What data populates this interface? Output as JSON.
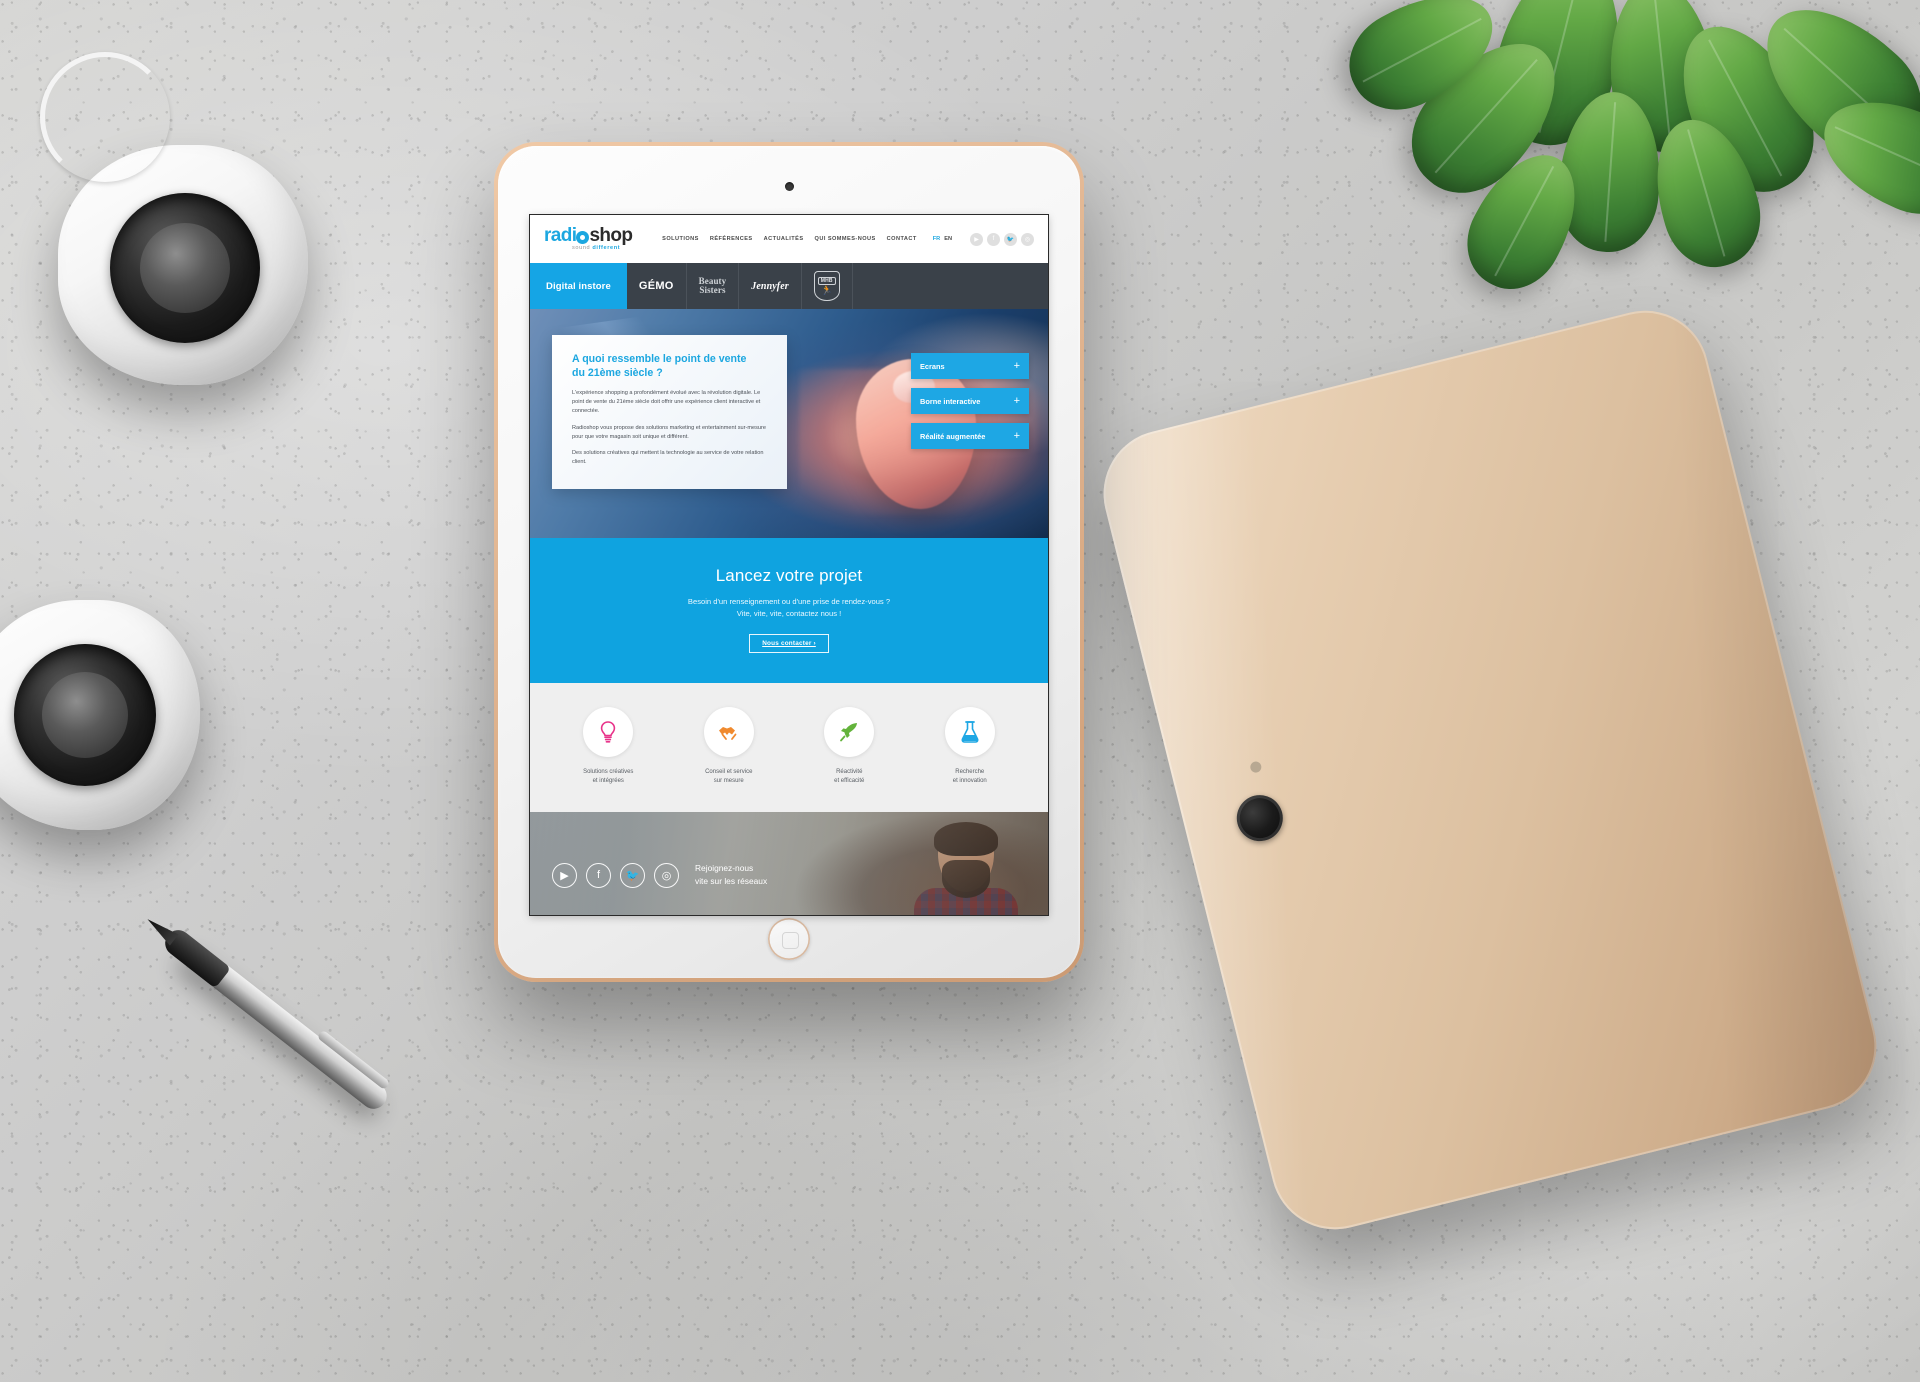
{
  "scene": {
    "description": "Tablet mockup on a concrete desk with speakers, a plant, a phone and a pen"
  },
  "site": {
    "logo": {
      "part1": "radi",
      "o": "o",
      "part2": "shop",
      "tagline_plain": "sound ",
      "tagline_accent": "different"
    },
    "nav": [
      {
        "label": "SOLUTIONS"
      },
      {
        "label": "RÉFÉRENCES"
      },
      {
        "label": "ACTUALITÉS"
      },
      {
        "label": "QUI SOMMES-NOUS"
      },
      {
        "label": "CONTACT"
      }
    ],
    "lang": {
      "fr": "FR",
      "en": "EN",
      "active": "FR"
    },
    "header_social": [
      {
        "name": "youtube-icon",
        "glyph": "▶"
      },
      {
        "name": "facebook-icon",
        "glyph": "f"
      },
      {
        "name": "twitter-icon",
        "glyph": "🐦"
      },
      {
        "name": "instagram-icon",
        "glyph": "◎"
      }
    ]
  },
  "tabs": [
    {
      "id": "digital-instore",
      "label": "Digital instore",
      "active": true,
      "style": "text"
    },
    {
      "id": "gemo",
      "label": "GÉMO",
      "active": false,
      "style": "gemo"
    },
    {
      "id": "beauty-sisters",
      "label": "Beauty\nSisters",
      "line1": "Beauty",
      "line2": "Sisters",
      "active": false,
      "style": "beauty"
    },
    {
      "id": "jennyfer",
      "label": "Jennyfer",
      "active": false,
      "style": "jenny"
    },
    {
      "id": "mhb",
      "label": "MHB",
      "badge_top": "MHB",
      "badge_figure": "🏃",
      "active": false,
      "style": "shield"
    }
  ],
  "hero": {
    "card": {
      "title_line1": "A quoi ressemble le point de vente",
      "title_line2": "du 21ème siècle ?",
      "paragraphs": [
        "L'expérience shopping a profondément évolué avec la révolution digitale. Le point de vente du 21ème siècle doit offrir une expérience client interactive et connectée.",
        "Radioshop vous propose des solutions marketing et entertainment sur-mesure pour que votre magasin soit unique et différent.",
        "Des solutions créatives qui mettent la technologie au service de votre relation client."
      ]
    },
    "accordion": [
      {
        "label": "Ecrans",
        "action": "+"
      },
      {
        "label": "Borne interactive",
        "action": "+"
      },
      {
        "label": "Réalité augmentée",
        "action": "+"
      }
    ]
  },
  "cta": {
    "title": "Lancez votre projet",
    "line1": "Besoin d'un renseignement ou d'une prise de rendez-vous ?",
    "line2": "Vite, vite, vite, contactez nous !",
    "button": "Nous contacter ›"
  },
  "features": [
    {
      "icon_name": "lightbulb-icon",
      "glyph": "💡",
      "line1": "Solutions créatives",
      "line2": "et intégrées",
      "color": "#e8338a"
    },
    {
      "icon_name": "handshake-icon",
      "glyph": "🤝",
      "line1": "Conseil et service",
      "line2": "sur mesure",
      "color": "#f08a2e"
    },
    {
      "icon_name": "rocket-icon",
      "glyph": "🚀",
      "line1": "Réactivité",
      "line2": "et efficacité",
      "color": "#63b33b"
    },
    {
      "icon_name": "flask-icon",
      "glyph": "⚗",
      "line1": "Recherche",
      "line2": "et innovation",
      "color": "#1ea7e4"
    }
  ],
  "footer": {
    "social": [
      {
        "name": "youtube-icon",
        "glyph": "▶"
      },
      {
        "name": "facebook-icon",
        "glyph": "f"
      },
      {
        "name": "twitter-icon",
        "glyph": "🐦"
      },
      {
        "name": "instagram-icon",
        "glyph": "◎"
      }
    ],
    "line1": "Rejoignez-nous",
    "line2": "vite sur les réseaux"
  },
  "colors": {
    "brand_blue": "#1ca7e0",
    "cta_blue": "#0fa3e0",
    "tab_dark": "#3a4149",
    "features_bg": "#efefef"
  }
}
